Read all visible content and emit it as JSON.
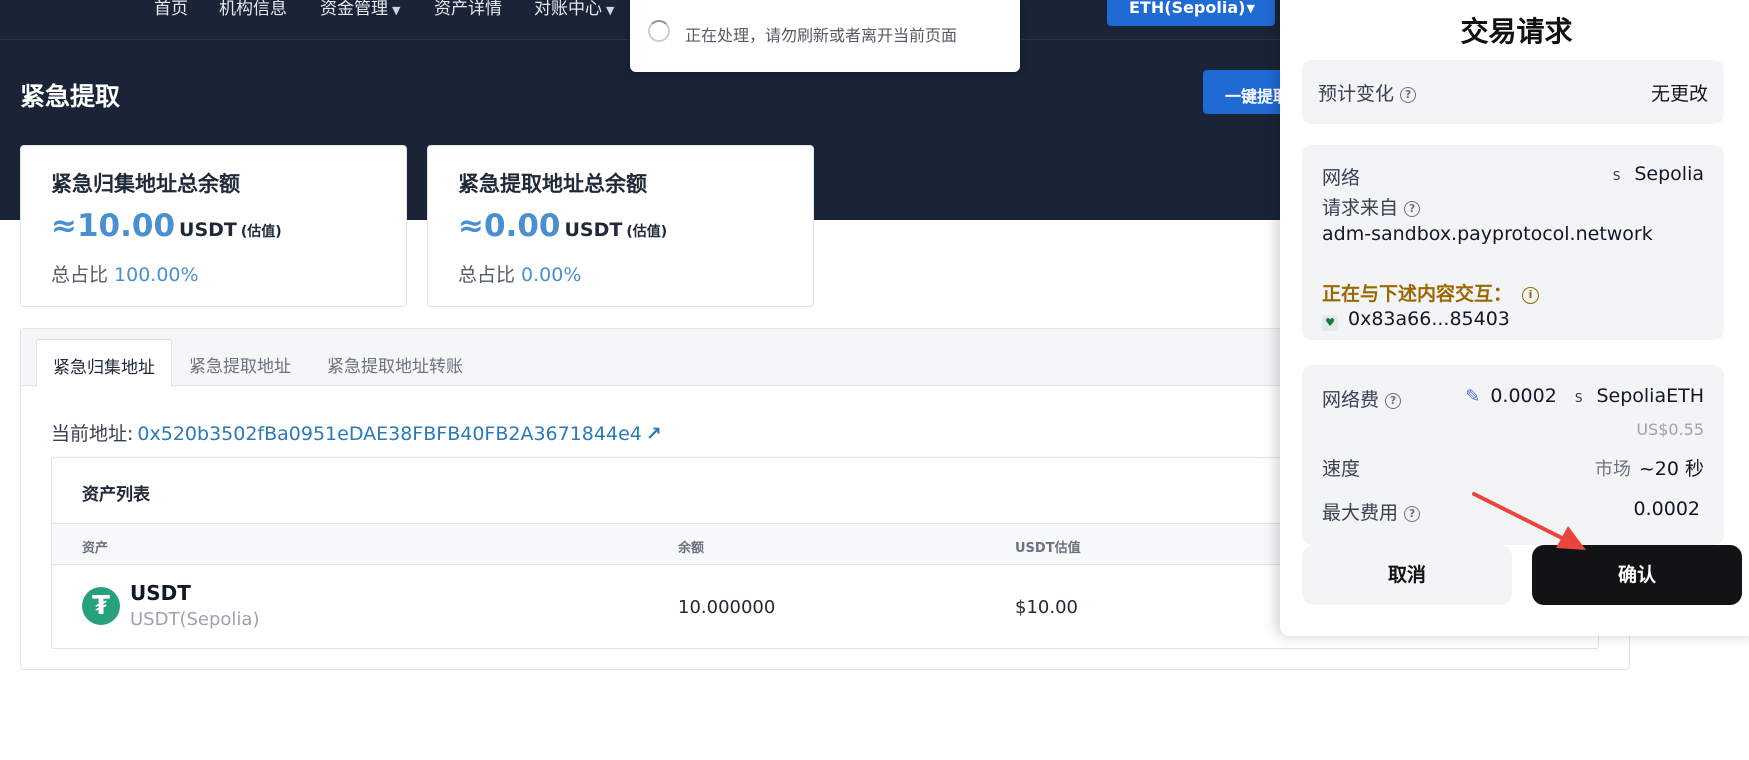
{
  "nav": {
    "items": [
      {
        "label": "首页",
        "caret": false
      },
      {
        "label": "机构信息",
        "caret": false
      },
      {
        "label": "资金管理",
        "caret": true
      },
      {
        "label": "资产详情",
        "caret": false
      },
      {
        "label": "对账中心",
        "caret": true
      }
    ],
    "network_label": "ETH(Sepolia)"
  },
  "processing": {
    "text": "正在处理，请勿刷新或者离开当前页面"
  },
  "page": {
    "title": "紧急提取",
    "one_key_label": "一键提取"
  },
  "cards": [
    {
      "title": "紧急归集地址总余额",
      "amount": "≈10.00",
      "unit": "USDT",
      "est": "(估值)",
      "ratio_label": "总占比",
      "ratio": "100.00%"
    },
    {
      "title": "紧急提取地址总余额",
      "amount": "≈0.00",
      "unit": "USDT",
      "est": "(估值)",
      "ratio_label": "总占比",
      "ratio": "0.00%"
    }
  ],
  "tabs": [
    {
      "label": "紧急归集地址",
      "active": true
    },
    {
      "label": "紧急提取地址",
      "active": false
    },
    {
      "label": "紧急提取地址转账",
      "active": false
    }
  ],
  "address": {
    "label": "当前地址:",
    "value": "0x520b3502fBa0951eDAE38FBFB40FB2A3671844e4",
    "icon": "external-link-icon"
  },
  "assets": {
    "title": "资产列表",
    "columns": [
      "资产",
      "余额",
      "USDT估值"
    ],
    "rows": [
      {
        "name": "USDT",
        "sub": "USDT(Sepolia)",
        "balance": "10.000000",
        "usdt_value": "$10.00"
      }
    ]
  },
  "wallet": {
    "title": "交易请求",
    "estimated_change_label": "预计变化",
    "estimated_change_value": "无更改",
    "network_label": "网络",
    "network_badge": "S",
    "network_value": "Sepolia",
    "request_from_label": "请求来自",
    "request_from_value": "adm-sandbox.payprotocol.network",
    "interacting_label": "正在与下述内容交互：",
    "contract_address": "0x83a66...85403",
    "fee_label": "网络费",
    "fee_amount": "0.0002",
    "fee_badge": "S",
    "fee_token": "SepoliaETH",
    "fee_usd": "US$0.55",
    "speed_label": "速度",
    "speed_mode": "市场",
    "speed_time": "~20 秒",
    "max_fee_label": "最大费用",
    "max_fee_value": "0.0002",
    "cancel_label": "取消",
    "confirm_label": "确认"
  },
  "colors": {
    "header_bg": "#1a2436",
    "accent_blue": "#1f6ad3",
    "link_blue": "#2b7ab8",
    "amount_blue": "#4a90d0",
    "warn": "#9a6700",
    "arrow": "#e8453c",
    "tether": "#26a17b"
  }
}
